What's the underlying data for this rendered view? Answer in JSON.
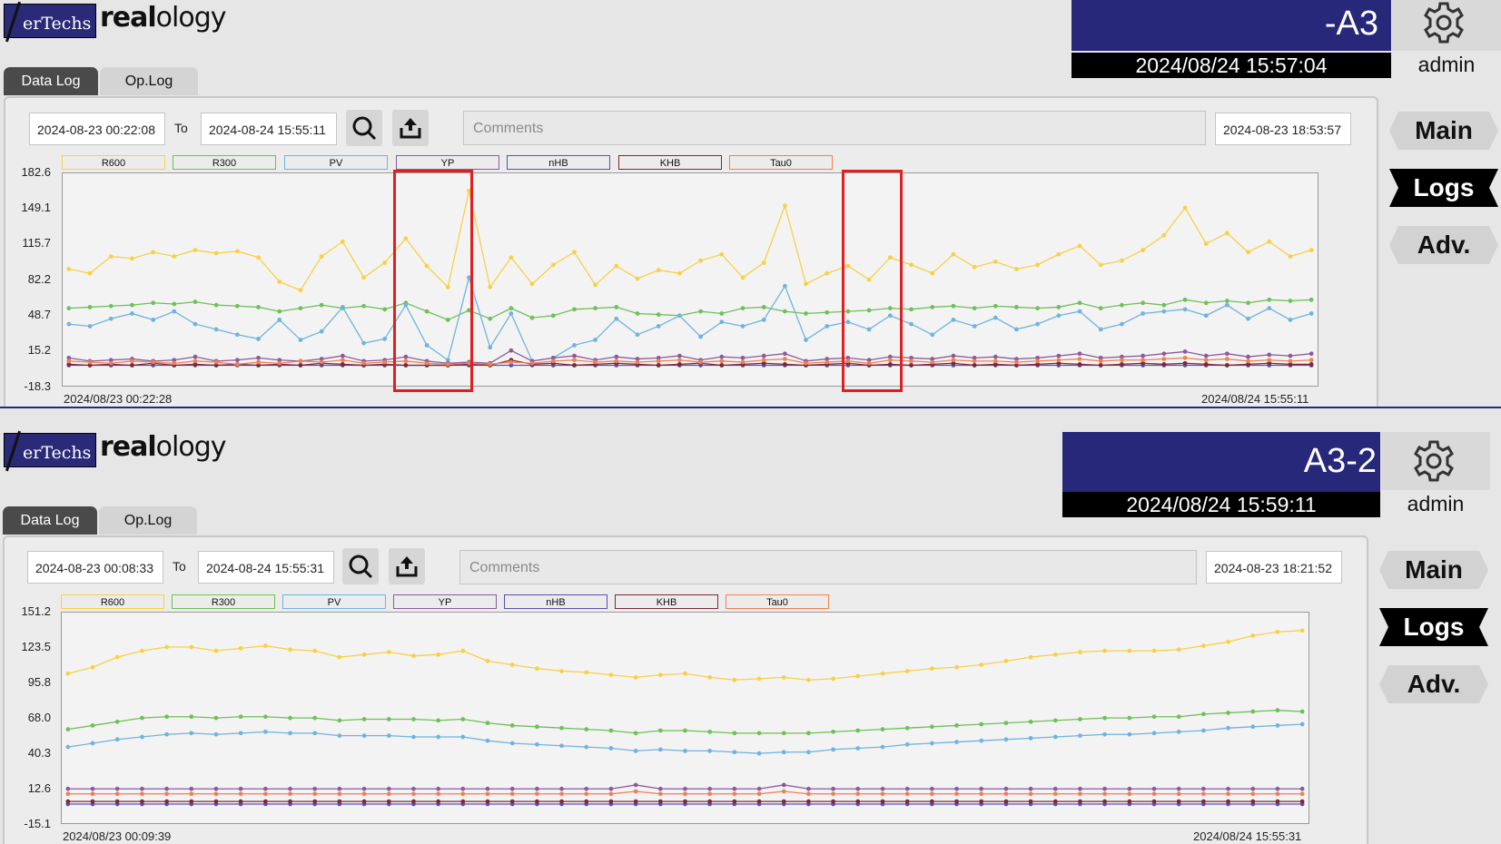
{
  "app": {
    "brand_box": "erTechs",
    "brand_name_bold": "real",
    "brand_name_light": "ology"
  },
  "panels": [
    {
      "device": "-A3",
      "datetime": "2024/08/24 15:57:04",
      "user": "admin",
      "tabs": [
        "Data Log",
        "Op.Log"
      ],
      "active_tab": "Data Log",
      "from": "2024-08-23  00:22:08",
      "to_label": "To",
      "to": "2024-08-24  15:55:11",
      "comments_placeholder": "Comments",
      "cursor_time": "2024-08-23  18:53:57",
      "nav": [
        "Main",
        "Logs",
        "Adv."
      ],
      "active_nav": "Logs",
      "x_start_label": "2024/08/23 00:22:28",
      "x_end_label": "2024/08/24 15:55:11"
    },
    {
      "device": "A3-2",
      "datetime": "2024/08/24 15:59:11",
      "user": "admin",
      "tabs": [
        "Data Log",
        "Op.Log"
      ],
      "active_tab": "Data Log",
      "from": "2024-08-23  00:08:33",
      "to_label": "To",
      "to": "2024-08-24  15:55:31",
      "comments_placeholder": "Comments",
      "cursor_time": "2024-08-23  18:21:52",
      "nav": [
        "Main",
        "Logs",
        "Adv."
      ],
      "active_nav": "Logs",
      "x_start_label": "2024/08/23 00:09:39",
      "x_end_label": "2024/08/24 15:55:31"
    }
  ],
  "icons": [
    "gear-icon",
    "search-icon",
    "export-icon"
  ],
  "colors": {
    "R600": "#f7d046",
    "R300": "#6fbf5a",
    "PV": "#6fb3e0",
    "YP": "#8b5a9e",
    "nHB": "#5a4fb0",
    "KHB": "#7a2a3a",
    "Tau0": "#f08050",
    "device_bg": "#27287a",
    "highlight": "#e02020"
  },
  "chart_data": [
    {
      "type": "line",
      "legend": [
        "R600",
        "R300",
        "PV",
        "YP",
        "nHB",
        "KHB",
        "Tau0"
      ],
      "yticks": [
        "182.6",
        "149.1",
        "115.7",
        "82.2",
        "48.7",
        "15.2",
        "-18.3"
      ],
      "ylim": [
        -18.3,
        182.6
      ],
      "x_range": [
        "2024/08/23 00:22:28",
        "2024/08/24 15:55:11"
      ],
      "grid": false,
      "series": [
        {
          "name": "R600",
          "values": [
            92,
            88,
            104,
            102,
            108,
            104,
            110,
            107,
            109,
            103,
            80,
            72,
            104,
            118,
            84,
            98,
            121,
            95,
            75,
            166,
            75,
            103,
            78,
            96,
            108,
            77,
            95,
            83,
            91,
            88,
            100,
            106,
            84,
            98,
            152,
            78,
            88,
            95,
            82,
            103,
            96,
            88,
            106,
            94,
            99,
            92,
            96,
            106,
            114,
            96,
            100,
            110,
            124,
            150,
            116,
            126,
            108,
            118,
            104,
            110
          ]
        },
        {
          "name": "R300",
          "values": [
            55,
            56,
            57,
            58,
            60,
            59,
            61,
            58,
            57,
            56,
            52,
            55,
            58,
            55,
            57,
            54,
            60,
            52,
            44,
            53,
            45,
            55,
            46,
            48,
            54,
            55,
            56,
            50,
            49,
            48,
            52,
            50,
            55,
            56,
            52,
            50,
            51,
            52,
            53,
            55,
            54,
            56,
            57,
            55,
            57,
            56,
            55,
            56,
            60,
            55,
            58,
            60,
            58,
            63,
            60,
            62,
            60,
            63,
            62,
            63
          ]
        },
        {
          "name": "PV",
          "values": [
            40,
            38,
            45,
            50,
            44,
            52,
            40,
            35,
            30,
            26,
            44,
            25,
            33,
            56,
            22,
            26,
            58,
            20,
            6,
            84,
            18,
            50,
            5,
            8,
            20,
            25,
            45,
            30,
            38,
            48,
            28,
            42,
            38,
            44,
            76,
            25,
            38,
            42,
            35,
            48,
            40,
            30,
            44,
            38,
            46,
            35,
            40,
            48,
            52,
            35,
            40,
            50,
            52,
            54,
            48,
            58,
            45,
            55,
            44,
            50
          ]
        },
        {
          "name": "YP",
          "values": [
            8,
            5,
            6,
            7,
            5,
            6,
            9,
            5,
            6,
            8,
            6,
            5,
            7,
            10,
            5,
            6,
            9,
            5,
            3,
            4,
            3,
            15,
            5,
            8,
            10,
            6,
            9,
            7,
            8,
            10,
            6,
            9,
            8,
            10,
            12,
            5,
            7,
            8,
            6,
            9,
            8,
            7,
            10,
            8,
            9,
            7,
            8,
            10,
            12,
            8,
            9,
            10,
            12,
            14,
            10,
            12,
            9,
            11,
            10,
            12
          ]
        },
        {
          "name": "nHB",
          "values": [
            1,
            1,
            1,
            1,
            1,
            1,
            1,
            1,
            1,
            1,
            1,
            1,
            1,
            1,
            1,
            1,
            1,
            1,
            1,
            1,
            1,
            1,
            1,
            1,
            1,
            1,
            1,
            1,
            1,
            1,
            1,
            1,
            1,
            1,
            1,
            1,
            1,
            1,
            1,
            1,
            1,
            1,
            1,
            1,
            1,
            1,
            1,
            1,
            1,
            1,
            1,
            1,
            1,
            1,
            1,
            1,
            1,
            1,
            1,
            1
          ]
        },
        {
          "name": "KHB",
          "values": [
            2,
            1,
            2,
            1,
            3,
            1,
            2,
            1,
            2,
            1,
            2,
            1,
            3,
            2,
            1,
            2,
            1,
            1,
            1,
            2,
            1,
            6,
            2,
            3,
            1,
            2,
            3,
            2,
            1,
            2,
            3,
            1,
            2,
            3,
            2,
            1,
            2,
            3,
            1,
            2,
            1,
            2,
            3,
            1,
            2,
            1,
            2,
            3,
            2,
            1,
            2,
            3,
            2,
            3,
            2,
            1,
            2,
            3,
            2,
            2
          ]
        },
        {
          "name": "Tau0",
          "values": [
            5,
            4,
            3,
            5,
            4,
            3,
            5,
            4,
            2,
            4,
            3,
            5,
            4,
            6,
            3,
            4,
            5,
            3,
            2,
            3,
            2,
            4,
            3,
            5,
            6,
            4,
            5,
            4,
            5,
            6,
            4,
            5,
            4,
            6,
            7,
            3,
            4,
            5,
            3,
            6,
            5,
            4,
            6,
            5,
            5,
            4,
            5,
            6,
            7,
            5,
            6,
            6,
            7,
            8,
            6,
            7,
            5,
            6,
            5,
            6
          ]
        }
      ]
    },
    {
      "type": "line",
      "legend": [
        "R600",
        "R300",
        "PV",
        "YP",
        "nHB",
        "KHB",
        "Tau0"
      ],
      "yticks": [
        "151.2",
        "123.5",
        "95.8",
        "68.0",
        "40.3",
        "12.6",
        "-15.1"
      ],
      "ylim": [
        -15.1,
        151.2
      ],
      "x_range": [
        "2024/08/23 00:09:39",
        "2024/08/24 15:55:31"
      ],
      "grid": false,
      "series": [
        {
          "name": "R600",
          "values": [
            103,
            108,
            116,
            121,
            124,
            124,
            121,
            123,
            125,
            122,
            121,
            116,
            118,
            120,
            117,
            118,
            121,
            113,
            110,
            107,
            105,
            104,
            102,
            100,
            102,
            103,
            100,
            98,
            99,
            100,
            98,
            99,
            101,
            103,
            105,
            107,
            108,
            110,
            113,
            116,
            118,
            120,
            121,
            121,
            121,
            122,
            125,
            128,
            133,
            136,
            137
          ]
        },
        {
          "name": "R300",
          "values": [
            59,
            62,
            65,
            68,
            69,
            69,
            68,
            69,
            69,
            68,
            68,
            66,
            67,
            67,
            67,
            66,
            67,
            64,
            62,
            61,
            60,
            59,
            58,
            56,
            58,
            58,
            57,
            56,
            56,
            56,
            56,
            57,
            58,
            59,
            60,
            61,
            62,
            63,
            64,
            65,
            66,
            67,
            68,
            68,
            69,
            69,
            71,
            72,
            73,
            74,
            73
          ]
        },
        {
          "name": "PV",
          "values": [
            45,
            48,
            51,
            53,
            55,
            56,
            55,
            56,
            57,
            56,
            56,
            54,
            54,
            54,
            53,
            53,
            53,
            50,
            48,
            47,
            46,
            45,
            44,
            42,
            43,
            42,
            42,
            41,
            40,
            41,
            41,
            43,
            44,
            45,
            47,
            48,
            49,
            50,
            51,
            52,
            53,
            54,
            55,
            55,
            56,
            57,
            58,
            60,
            61,
            62,
            63
          ]
        },
        {
          "name": "YP",
          "values": [
            12,
            12,
            12,
            12,
            12,
            12,
            12,
            12,
            12,
            12,
            12,
            12,
            12,
            12,
            12,
            12,
            12,
            12,
            12,
            12,
            12,
            12,
            12,
            15,
            12,
            12,
            12,
            12,
            12,
            15,
            12,
            12,
            12,
            12,
            12,
            12,
            12,
            12,
            12,
            12,
            12,
            12,
            12,
            12,
            12,
            12,
            12,
            12,
            12,
            12,
            12
          ]
        },
        {
          "name": "nHB",
          "values": [
            0,
            0,
            0,
            0,
            0,
            0,
            0,
            0,
            0,
            0,
            0,
            0,
            0,
            0,
            0,
            0,
            0,
            0,
            0,
            0,
            0,
            0,
            0,
            0,
            0,
            0,
            0,
            0,
            0,
            0,
            0,
            0,
            0,
            0,
            0,
            0,
            0,
            0,
            0,
            0,
            0,
            0,
            0,
            0,
            0,
            0,
            0,
            0,
            0,
            0,
            0
          ]
        },
        {
          "name": "KHB",
          "values": [
            2,
            2,
            2,
            2,
            2,
            2,
            2,
            2,
            2,
            2,
            2,
            2,
            2,
            2,
            2,
            2,
            2,
            2,
            2,
            2,
            2,
            2,
            2,
            2,
            2,
            2,
            2,
            2,
            2,
            2,
            2,
            2,
            2,
            2,
            2,
            2,
            2,
            2,
            2,
            2,
            2,
            2,
            2,
            2,
            2,
            2,
            2,
            2,
            2,
            2,
            2
          ]
        },
        {
          "name": "Tau0",
          "values": [
            8,
            8,
            8,
            8,
            8,
            8,
            8,
            8,
            8,
            8,
            8,
            8,
            8,
            8,
            8,
            8,
            8,
            8,
            8,
            8,
            8,
            8,
            8,
            10,
            8,
            8,
            8,
            8,
            8,
            10,
            8,
            8,
            8,
            8,
            8,
            8,
            8,
            8,
            8,
            8,
            8,
            8,
            8,
            8,
            8,
            8,
            8,
            8,
            8,
            8,
            8
          ]
        }
      ]
    }
  ]
}
